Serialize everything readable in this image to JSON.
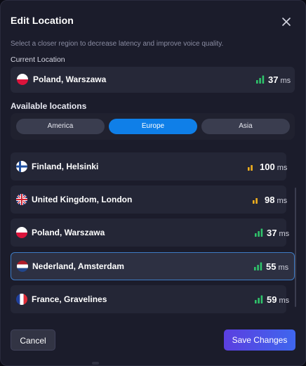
{
  "dialog": {
    "title": "Edit Location",
    "subtitle": "Select a closer region to decrease latency and improve voice quality."
  },
  "current": {
    "label": "Current Location",
    "name": "Poland, Warszawa",
    "flag_icon": "poland-flag-icon",
    "ping": "37",
    "unit": "ms",
    "signal": "good"
  },
  "available": {
    "label": "Available locations",
    "tabs": [
      {
        "label": "America",
        "active": false
      },
      {
        "label": "Europe",
        "active": true
      },
      {
        "label": "Asia",
        "active": false
      }
    ]
  },
  "locations": [
    {
      "name": "Finland, Helsinki",
      "flag_icon": "finland-flag-icon",
      "ping": "100",
      "unit": "ms",
      "signal": "medium",
      "selected": false
    },
    {
      "name": "United Kingdom, London",
      "flag_icon": "uk-flag-icon",
      "ping": "98",
      "unit": "ms",
      "signal": "medium",
      "selected": false
    },
    {
      "name": "Poland, Warszawa",
      "flag_icon": "poland-flag-icon",
      "ping": "37",
      "unit": "ms",
      "signal": "good",
      "selected": false
    },
    {
      "name": "Nederland, Amsterdam",
      "flag_icon": "netherlands-flag-icon",
      "ping": "55",
      "unit": "ms",
      "signal": "good",
      "selected": true
    },
    {
      "name": "France, Gravelines",
      "flag_icon": "france-flag-icon",
      "ping": "59",
      "unit": "ms",
      "signal": "good",
      "selected": false
    }
  ],
  "actions": {
    "cancel_label": "Cancel",
    "save_label": "Save Changes"
  },
  "colors": {
    "accent": "#0f7fe8",
    "signal_good": "#2fc46b",
    "signal_medium": "#f2b01e",
    "save_start": "#5b3fe0",
    "save_end": "#3f66ee"
  }
}
